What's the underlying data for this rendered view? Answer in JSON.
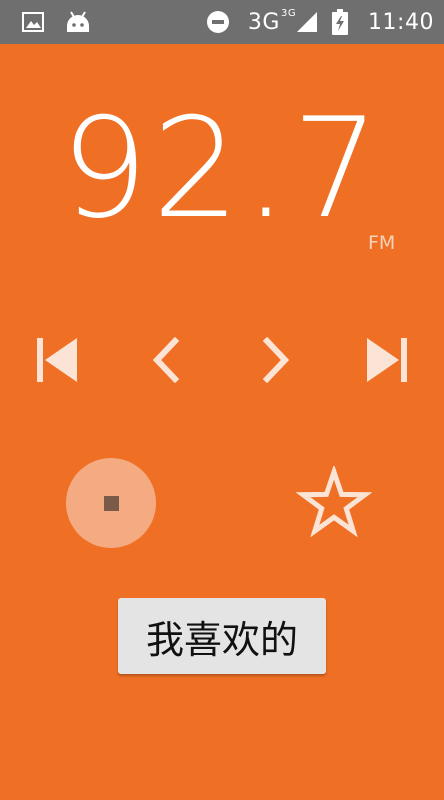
{
  "status_bar": {
    "network": "3G",
    "network_superscript": "3G",
    "time": "11:40",
    "icons": [
      "image-icon",
      "android-icon",
      "do-not-disturb-icon",
      "signal-icon",
      "battery-icon"
    ]
  },
  "radio": {
    "frequency": "92.7",
    "unit": "FM"
  },
  "controls": {
    "icons": [
      "skip-previous-icon",
      "chevron-left-icon",
      "chevron-right-icon",
      "skip-next-icon",
      "stop-icon",
      "star-outline-icon"
    ]
  },
  "favorites": {
    "label": "我喜欢的"
  },
  "colors": {
    "background": "#EF7024",
    "status_bar": "#6F6F6F",
    "icon": "#FBE3D5",
    "record_button": "#F5AB82",
    "favorites_button": "#E4E4E4"
  }
}
